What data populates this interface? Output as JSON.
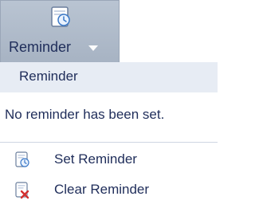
{
  "ribbon": {
    "label": "Reminder",
    "icon": "reminder-document-clock-icon"
  },
  "menu": {
    "header_title": "Reminder",
    "status_text": "No reminder has been set.",
    "items": [
      {
        "label": "Set Reminder",
        "icon": "set-reminder-icon"
      },
      {
        "label": "Clear Reminder",
        "icon": "clear-reminder-icon"
      }
    ]
  },
  "colors": {
    "text": "#1f2d5a",
    "ribbon_bg": "#aab6c5",
    "header_bg": "#e7ecf4",
    "separator": "#cfd6e3",
    "clear_icon_red": "#d32f2f",
    "icon_blue": "#3b79c7"
  }
}
